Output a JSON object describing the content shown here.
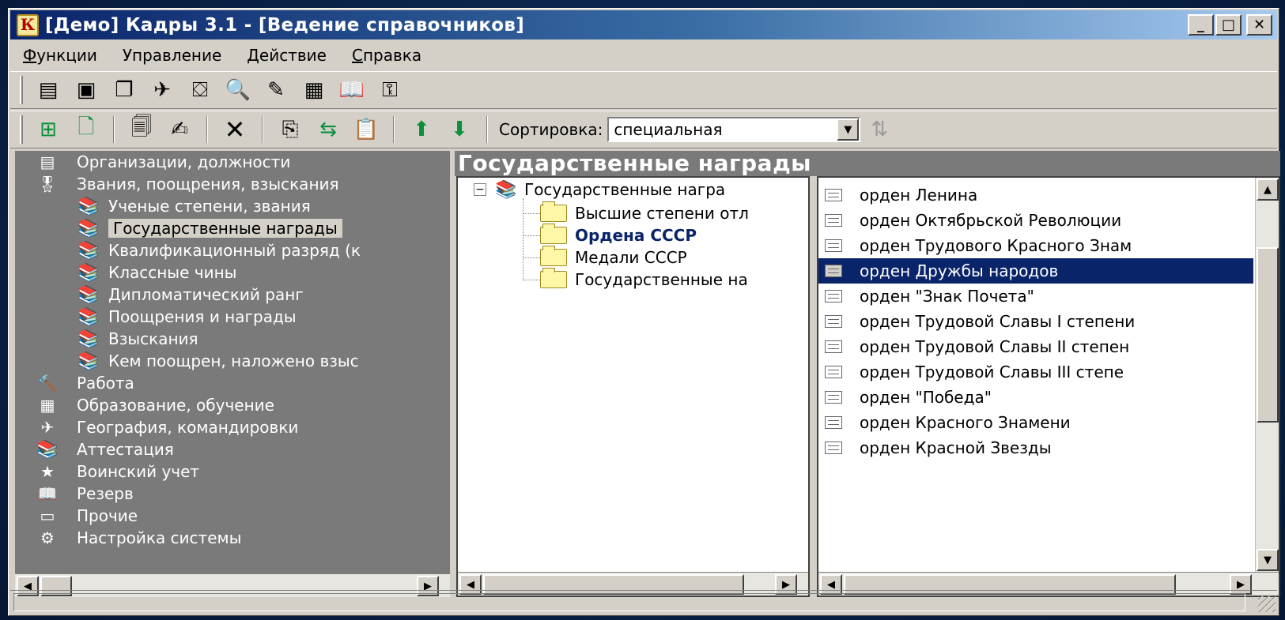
{
  "window": {
    "title": "[Демо] Кадры 3.1 - [Ведение справочников]",
    "controls": {
      "minimize": "_",
      "maximize": "□",
      "close": "✕"
    }
  },
  "menu": [
    {
      "pre": "",
      "u": "Ф",
      "post": "ункции"
    },
    {
      "pre": "",
      "u": "",
      "post": "Управление"
    },
    {
      "pre": "",
      "u": "",
      "post": "Действие"
    },
    {
      "pre": "",
      "u": "С",
      "post": "правка"
    }
  ],
  "toolbar2": {
    "sort_label": "Сортировка:",
    "sort_value": "специальная"
  },
  "left_nav": [
    {
      "label": "Организации, должности",
      "level": 0,
      "icon": "organization-icon",
      "glyph": "▤"
    },
    {
      "label": "Звания, поощрения, взыскания",
      "level": 0,
      "icon": "medal-icon",
      "glyph": "🎖"
    },
    {
      "label": "Ученые степени, звания",
      "level": 1,
      "icon": "books-icon",
      "glyph": "📚"
    },
    {
      "label": "Государственные награды",
      "level": 1,
      "icon": "books-icon",
      "glyph": "📚",
      "selected": true
    },
    {
      "label": "Квалификационный разряд (к",
      "level": 1,
      "icon": "books-icon",
      "glyph": "📚"
    },
    {
      "label": "Классные чины",
      "level": 1,
      "icon": "books-icon",
      "glyph": "📚"
    },
    {
      "label": "Дипломатический ранг",
      "level": 1,
      "icon": "books-icon",
      "glyph": "📚"
    },
    {
      "label": "Поощрения и награды",
      "level": 1,
      "icon": "books-icon",
      "glyph": "📚"
    },
    {
      "label": "Взыскания",
      "level": 1,
      "icon": "books-icon",
      "glyph": "📚"
    },
    {
      "label": "Кем поощрен, наложено взыс",
      "level": 1,
      "icon": "books-icon",
      "glyph": "📚"
    },
    {
      "label": "Работа",
      "level": 0,
      "icon": "work-icon",
      "glyph": "🔨"
    },
    {
      "label": "Образование, обучение",
      "level": 0,
      "icon": "education-icon",
      "glyph": "▦"
    },
    {
      "label": "География, командировки",
      "level": 0,
      "icon": "plane-icon",
      "glyph": "✈"
    },
    {
      "label": "Аттестация",
      "level": 0,
      "icon": "books-icon",
      "glyph": "📚"
    },
    {
      "label": "Воинский учет",
      "level": 0,
      "icon": "star-icon",
      "glyph": "★"
    },
    {
      "label": "Резерв",
      "level": 0,
      "icon": "book-icon",
      "glyph": "📖"
    },
    {
      "label": "Прочие",
      "level": 0,
      "icon": "window-icon",
      "glyph": "▭"
    },
    {
      "label": "Настройка системы",
      "level": 0,
      "icon": "settings-icon",
      "glyph": "⚙"
    }
  ],
  "main": {
    "heading": "Государственные награды",
    "tree": {
      "root": {
        "label": "Государственные награ",
        "expander": "−"
      },
      "children": [
        {
          "label": "Высшие степени отл",
          "bold": false
        },
        {
          "label": "Ордена СССР",
          "bold": true
        },
        {
          "label": "Медали СССР",
          "bold": false
        },
        {
          "label": "Государственные на",
          "bold": false
        }
      ]
    },
    "list": [
      {
        "label": "орден Ленина"
      },
      {
        "label": "орден Октябрьской Революции"
      },
      {
        "label": "орден Трудового Красного Знам"
      },
      {
        "label": "орден Дружбы народов",
        "selected": true
      },
      {
        "label": "орден \"Знак Почета\""
      },
      {
        "label": "орден Трудовой Славы I степени"
      },
      {
        "label": "орден Трудовой Славы II степен"
      },
      {
        "label": "орден Трудовой Славы III степе"
      },
      {
        "label": "орден \"Победа\""
      },
      {
        "label": "орден Красного Знамени"
      },
      {
        "label": "орден Красной Звезды"
      }
    ]
  }
}
